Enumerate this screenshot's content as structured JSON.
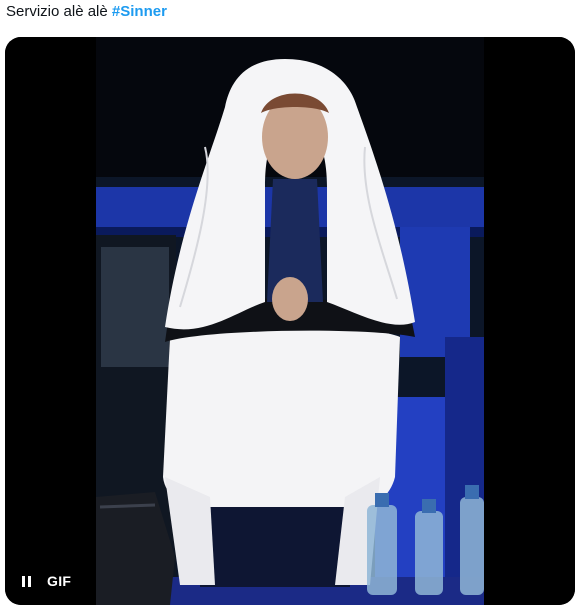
{
  "tweet": {
    "text": "Servizio alè alè ",
    "hashtag": "#Sinner"
  },
  "media": {
    "type": "gif",
    "badge": "GIF",
    "playback_state": "playing",
    "control_icon": "pause-icon"
  },
  "colors": {
    "hashtag": "#1d9bf0",
    "text": "#0f1419",
    "media_background": "#000000",
    "court_blue": "#1c36a8"
  }
}
